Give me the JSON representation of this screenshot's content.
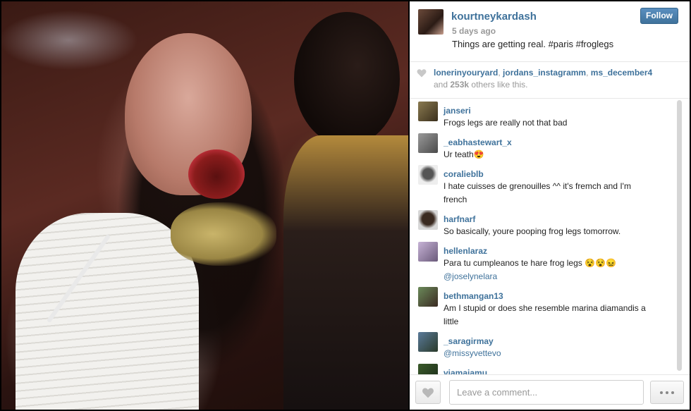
{
  "post": {
    "username": "kourtneykardash",
    "timestamp": "5 days ago",
    "caption": "Things are getting real. #paris #froglegs",
    "follow_label": "Follow"
  },
  "likes": {
    "users": [
      "lonerinyouryard",
      "jordans_instagramm",
      "ms_december4"
    ],
    "separator": ",",
    "and_label": "and",
    "count": "253k",
    "suffix": "others like this."
  },
  "comments": [
    {
      "user": "janseri",
      "text": "Frogs legs are really not that bad",
      "text2": ""
    },
    {
      "user": "_eabhastewart_x",
      "text": "Ur teath😍",
      "text2": ""
    },
    {
      "user": "coralieblb",
      "text": "I hate cuisses de grenouilles ^^ it's fremch and I'm",
      "text2b": "french"
    },
    {
      "user": "harfnarf",
      "text": "So basically, youre pooping frog legs tomorrow.",
      "text2": ""
    },
    {
      "user": "hellenlaraz",
      "text": "Para tu cumpleanos te hare frog legs 😵😵😖",
      "text2": "@joselynelara"
    },
    {
      "user": "bethmangan13",
      "text": "Am I stupid or does she resemble marina diamandis a",
      "text2b": "little"
    },
    {
      "user": "_saragirmay",
      "text": "",
      "text2": "@missyvettevo"
    },
    {
      "user": "viamaiamu",
      "text": "",
      "text2": ""
    }
  ],
  "footer": {
    "comment_placeholder": "Leave a comment..."
  },
  "icons": {
    "heart": "heart-icon",
    "more": "more-options-icon"
  },
  "colors": {
    "link": "#3f729b",
    "muted": "#999999",
    "follow_bg": "#3f729b"
  }
}
